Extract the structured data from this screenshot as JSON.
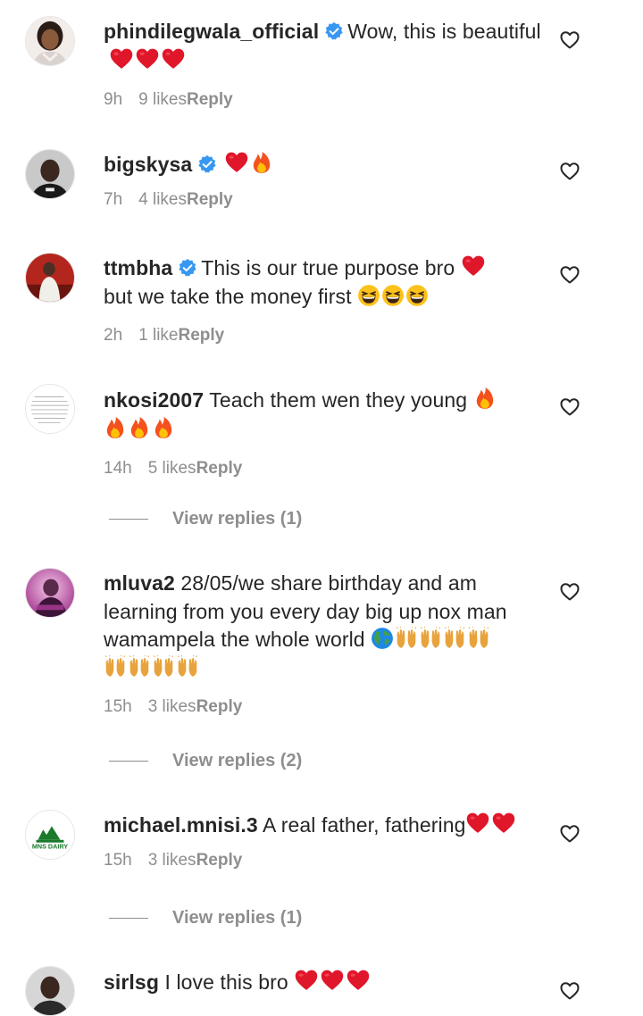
{
  "comments": [
    {
      "username": "phindilegwala_official",
      "verified": true,
      "text": "Wow, this is beautiful",
      "time": "9h",
      "likes": "9 likes",
      "reply": "Reply"
    },
    {
      "username": "bigskysa",
      "verified": true,
      "text": "",
      "time": "7h",
      "likes": "4 likes",
      "reply": "Reply"
    },
    {
      "username": "ttmbha",
      "verified": true,
      "text": "This is our true purpose bro",
      "text2": "but we take the money first",
      "time": "2h",
      "likes": "1 like",
      "reply": "Reply"
    },
    {
      "username": "nkosi2007",
      "verified": false,
      "text": "Teach them wen they young",
      "time": "14h",
      "likes": "5 likes",
      "reply": "Reply",
      "view_replies": "View replies (1)"
    },
    {
      "username": "mluva2",
      "verified": false,
      "text": "28/05/we share birthday and am learning from you every day big up nox man wamampela the whole world",
      "time": "15h",
      "likes": "3 likes",
      "reply": "Reply",
      "view_replies": "View replies (2)"
    },
    {
      "username": "michael.mnisi.3",
      "verified": false,
      "text": "A real father, fathering",
      "time": "15h",
      "likes": "3 likes",
      "reply": "Reply",
      "view_replies": "View replies (1)",
      "avatar_text": "MNS DAIRY"
    },
    {
      "username": "sirlsg",
      "verified": false,
      "text": "I love this bro"
    }
  ],
  "colors": {
    "text": "#262626",
    "meta": "#8e8e8e",
    "verified": "#3897f0",
    "heart": "#ed1c2e"
  },
  "icons": {
    "verified": "verified-badge-icon",
    "like": "heart-outline-icon",
    "emoji_heart": "red-heart-emoji",
    "emoji_fire": "fire-emoji",
    "emoji_laugh": "grinning-squinting-emoji",
    "emoji_globe": "globe-emoji",
    "emoji_hands": "raising-hands-emoji"
  }
}
